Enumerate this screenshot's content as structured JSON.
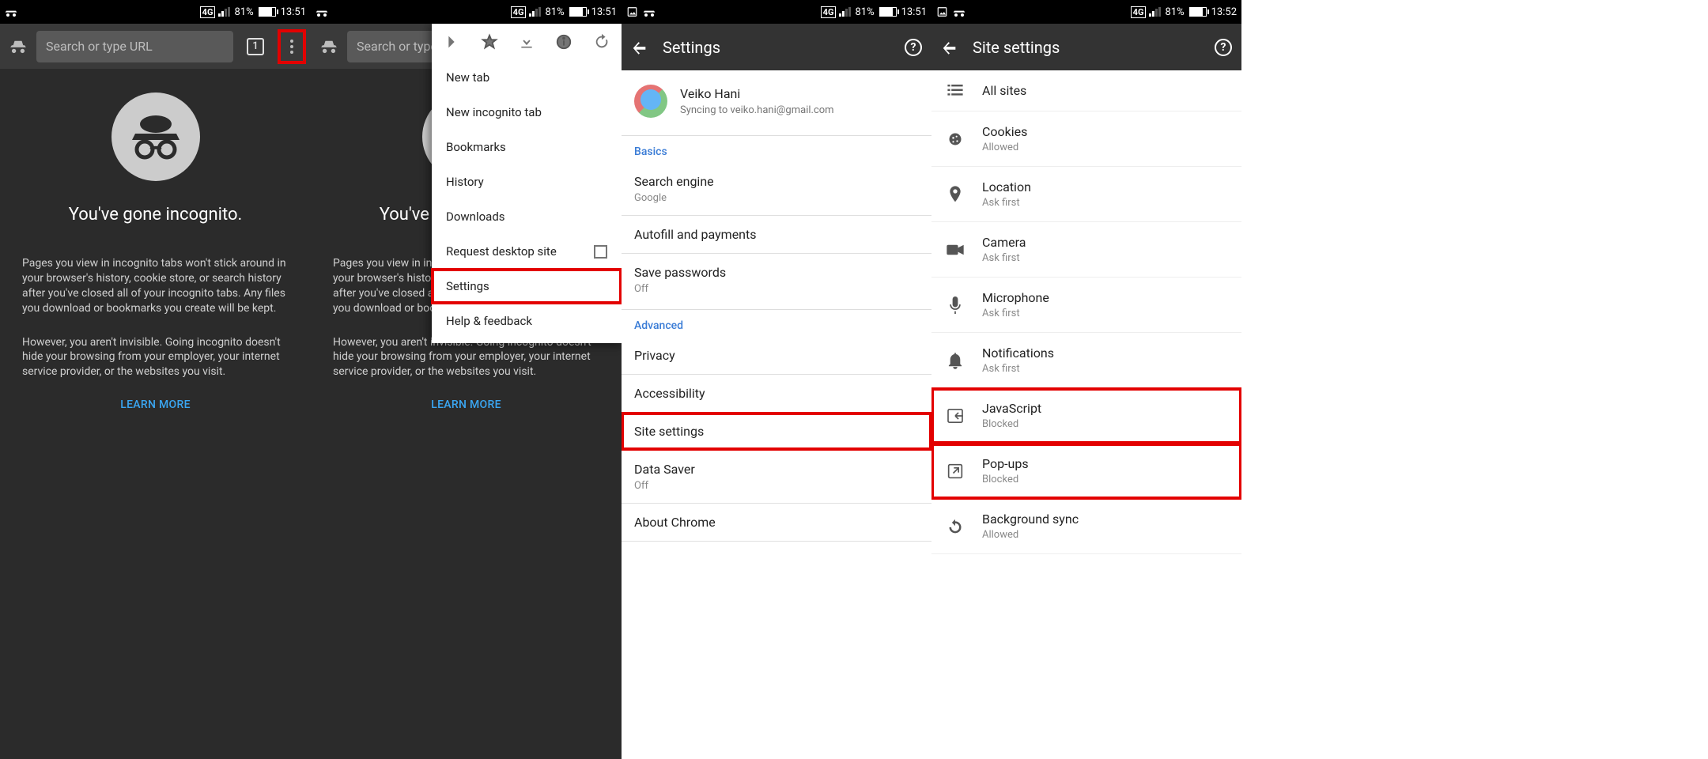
{
  "status": {
    "network": "4G",
    "battery_pct": "81%",
    "time_a": "13:51",
    "time_b": "13:52"
  },
  "omnibox": {
    "placeholder": "Search or type URL",
    "tab_count": "1"
  },
  "incognito": {
    "title": "You've gone incognito.",
    "para1": "Pages you view in incognito tabs won't stick around in your browser's history, cookie store, or search history after you've closed all of your incognito tabs. Any files you download or bookmarks you create will be kept.",
    "para2": "However, you aren't invisible. Going incognito doesn't hide your browsing from your employer, your internet service provider, or the websites you visit.",
    "learn_more": "LEARN MORE"
  },
  "menu": {
    "items": [
      {
        "label": "New tab"
      },
      {
        "label": "New incognito tab"
      },
      {
        "label": "Bookmarks"
      },
      {
        "label": "History"
      },
      {
        "label": "Downloads"
      },
      {
        "label": "Request desktop site",
        "checkbox": true
      },
      {
        "label": "Settings",
        "highlight": true
      },
      {
        "label": "Help & feedback"
      }
    ]
  },
  "settings": {
    "title": "Settings",
    "account": {
      "name": "Veiko Hani",
      "sub": "Syncing to veiko.hani@gmail.com"
    },
    "basics_head": "Basics",
    "basics": [
      {
        "label": "Search engine",
        "sub": "Google"
      },
      {
        "label": "Autofill and payments"
      },
      {
        "label": "Save passwords",
        "sub": "Off"
      }
    ],
    "advanced_head": "Advanced",
    "advanced": [
      {
        "label": "Privacy"
      },
      {
        "label": "Accessibility"
      },
      {
        "label": "Site settings",
        "highlight": true
      },
      {
        "label": "Data Saver",
        "sub": "Off"
      },
      {
        "label": "About Chrome"
      }
    ]
  },
  "site_settings": {
    "title": "Site settings",
    "rows": [
      {
        "label": "All sites",
        "icon": "list"
      },
      {
        "label": "Cookies",
        "sub": "Allowed",
        "icon": "cookie"
      },
      {
        "label": "Location",
        "sub": "Ask first",
        "icon": "pin"
      },
      {
        "label": "Camera",
        "sub": "Ask first",
        "icon": "camera"
      },
      {
        "label": "Microphone",
        "sub": "Ask first",
        "icon": "mic"
      },
      {
        "label": "Notifications",
        "sub": "Ask first",
        "icon": "bell"
      },
      {
        "label": "JavaScript",
        "sub": "Blocked",
        "icon": "js",
        "highlight": true
      },
      {
        "label": "Pop-ups",
        "sub": "Blocked",
        "icon": "popup",
        "highlight": true
      },
      {
        "label": "Background sync",
        "sub": "Allowed",
        "icon": "sync"
      }
    ]
  }
}
